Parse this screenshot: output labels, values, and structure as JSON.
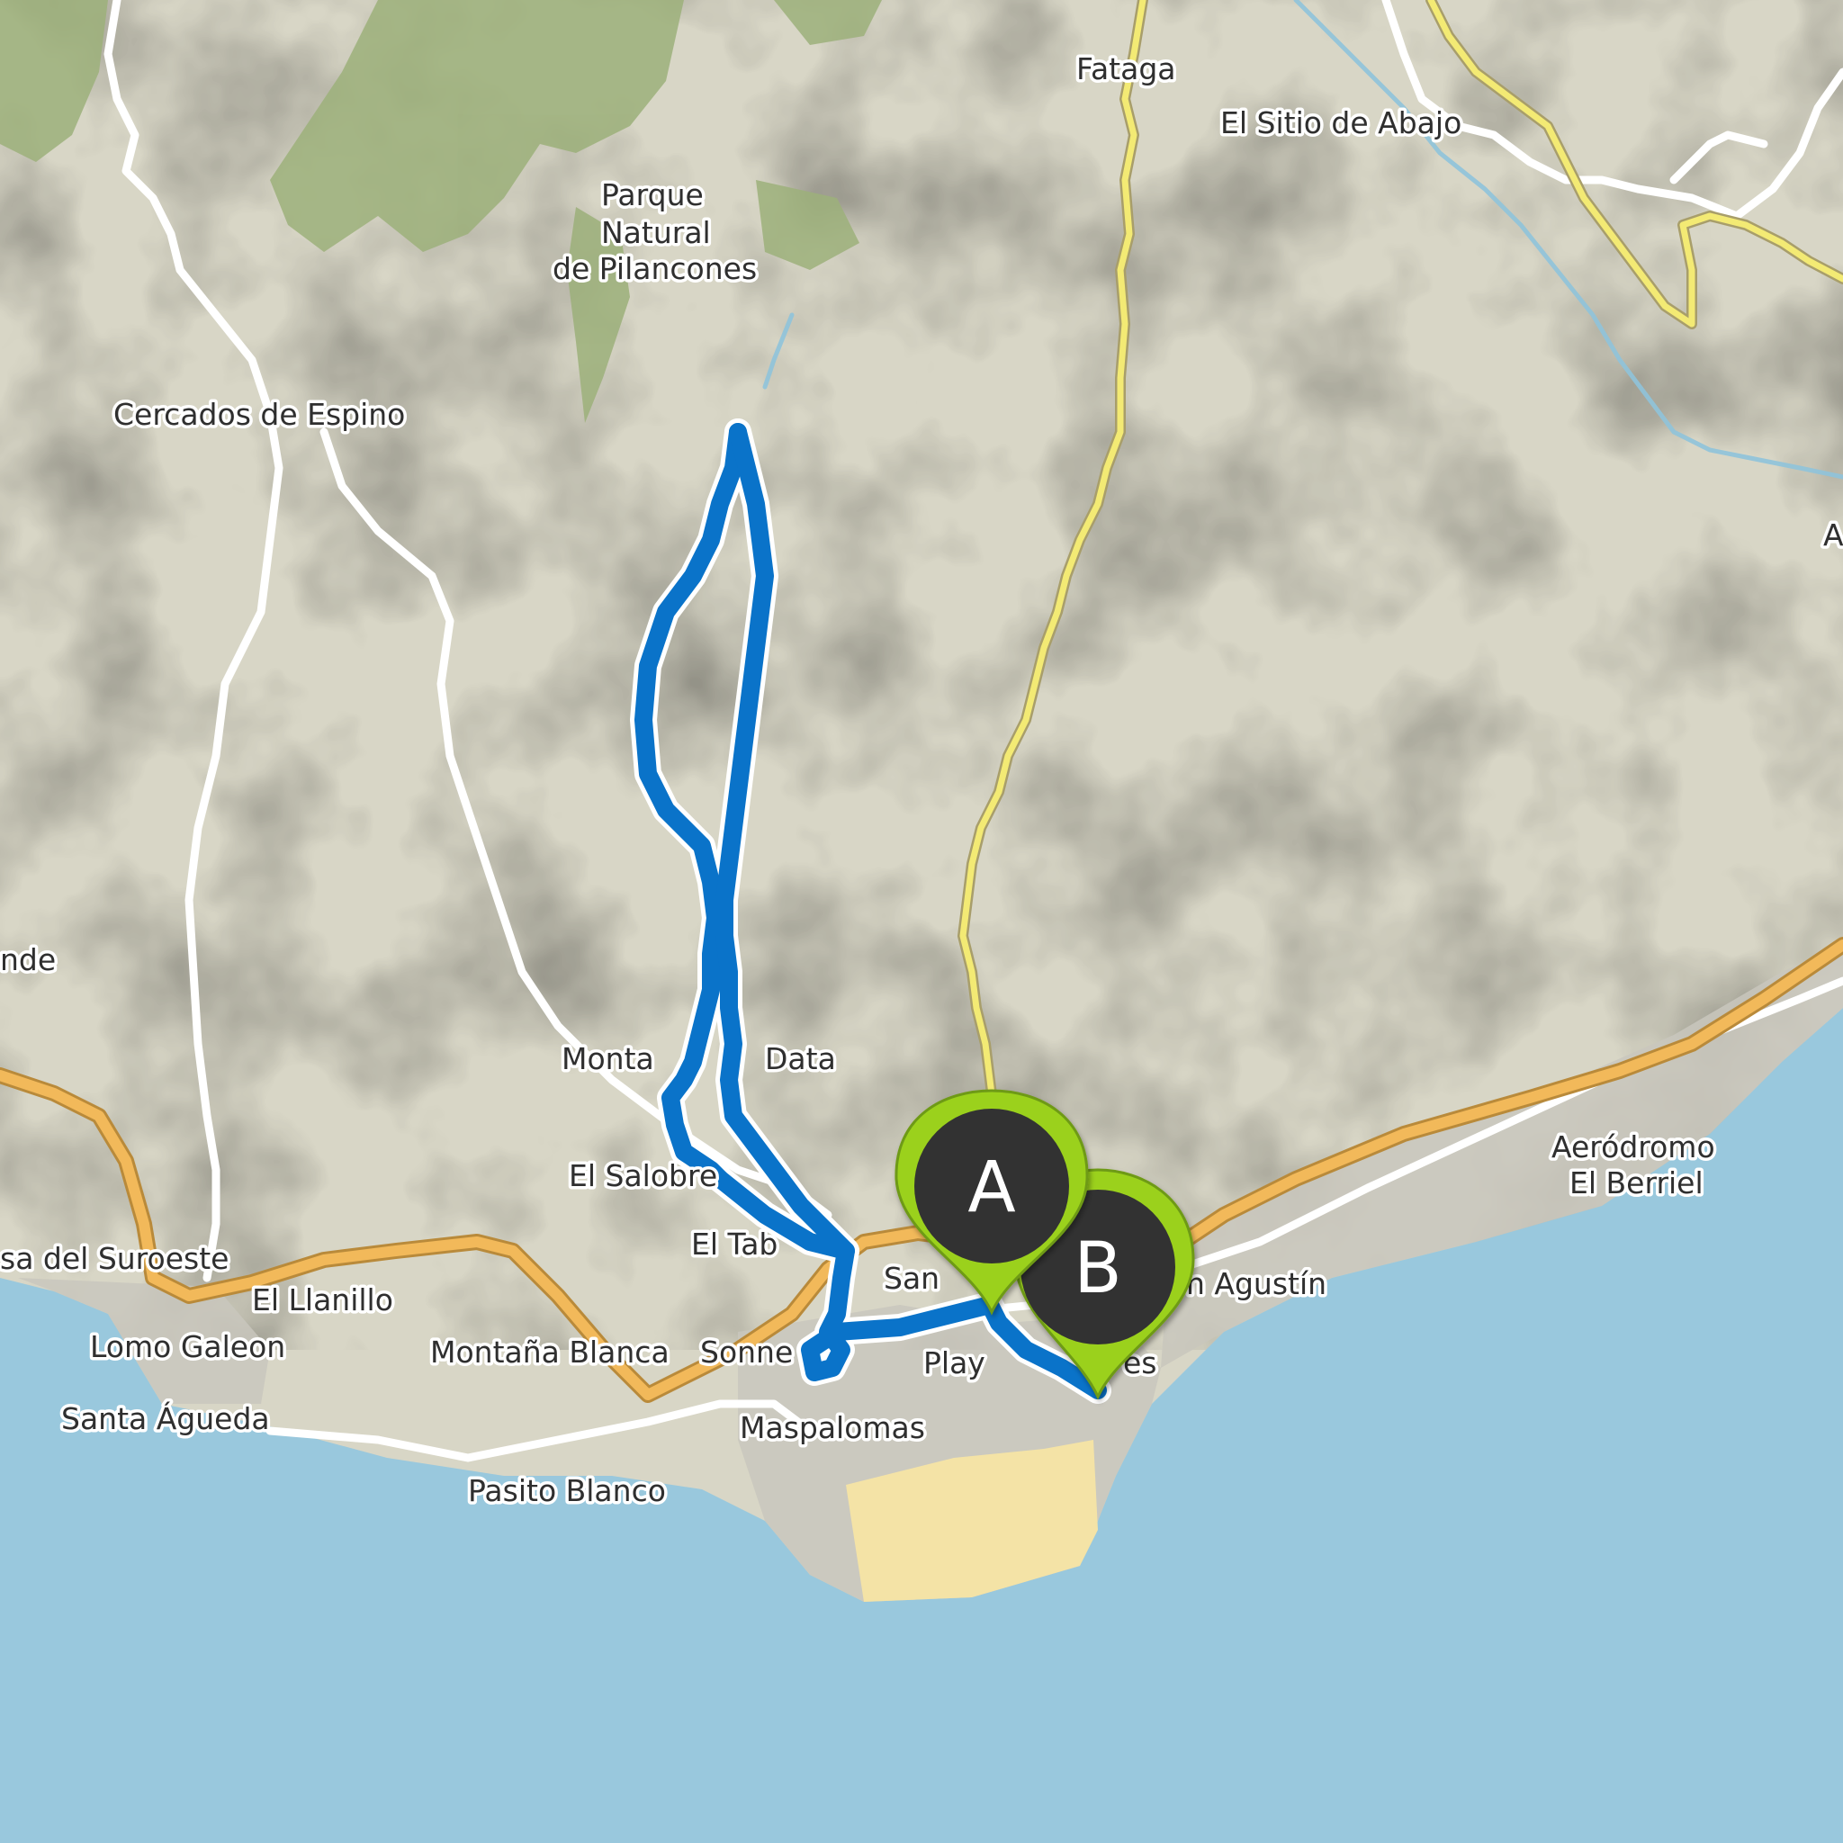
{
  "map": {
    "places": [
      {
        "id": "fataga",
        "label": "Fataga"
      },
      {
        "id": "el-sitio-de-abajo",
        "label": "El Sitio de Abajo"
      },
      {
        "id": "parque-line-1",
        "label": "Parque"
      },
      {
        "id": "parque-line-2",
        "label": "Natural"
      },
      {
        "id": "parque-line-3",
        "label": "de Pilancones"
      },
      {
        "id": "cercados-de-espino",
        "label": "Cercados de Espino"
      },
      {
        "id": "nde",
        "label": "nde"
      },
      {
        "id": "montana-data-left",
        "label": "Monta"
      },
      {
        "id": "montana-data-right",
        "label": "Data"
      },
      {
        "id": "el-salobre",
        "label": "El Salobre"
      },
      {
        "id": "el-tabl",
        "label": "El Tab"
      },
      {
        "id": "san",
        "label": "San"
      },
      {
        "id": "san-agustin",
        "label": "n Agustín"
      },
      {
        "id": "aerodromo-line-1",
        "label": "Aeródromo"
      },
      {
        "id": "aerodromo-line-2",
        "label": "El Berriel"
      },
      {
        "id": "suroeste",
        "label": "sa del Suroeste"
      },
      {
        "id": "el-llanillo",
        "label": "El Llanillo"
      },
      {
        "id": "lomo-galeon",
        "label": "Lomo Galeon"
      },
      {
        "id": "montana-blanca",
        "label": "Montaña Blanca"
      },
      {
        "id": "sonne",
        "label": "Sonne"
      },
      {
        "id": "playa",
        "label": "Play"
      },
      {
        "id": "es",
        "label": "es"
      },
      {
        "id": "santa-agueda",
        "label": "Santa Águeda"
      },
      {
        "id": "maspalomas",
        "label": "Maspalomas"
      },
      {
        "id": "pasito-blanco",
        "label": "Pasito Blanco"
      },
      {
        "id": "edge-a",
        "label": "A"
      }
    ],
    "markers": [
      {
        "id": "start",
        "letter": "A"
      },
      {
        "id": "end",
        "letter": "B"
      }
    ],
    "colors": {
      "sea": "#99c8dd",
      "land": "#d8d6c6",
      "forest": "#9cb07a",
      "route": "#0a73c9",
      "motorway": "#f2b95a",
      "secondary_road": "#f3ea74",
      "marker_fill": "#9bd11f",
      "marker_inner": "#333333",
      "beach": "#f4e3a6"
    }
  }
}
